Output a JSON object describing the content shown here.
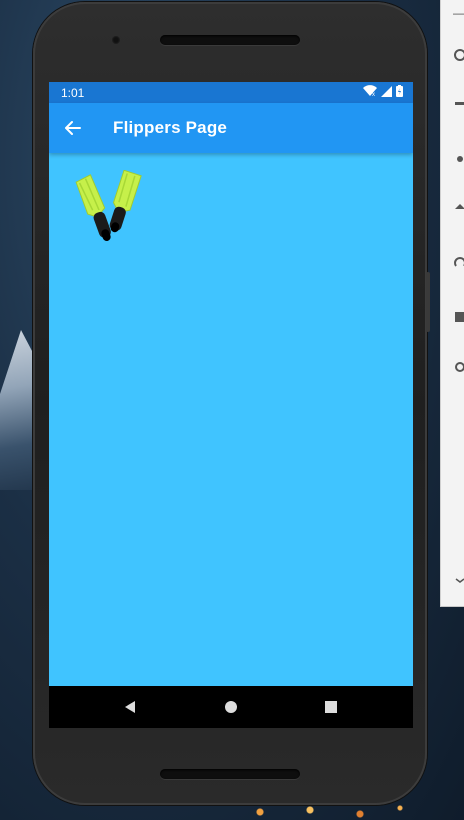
{
  "status_bar": {
    "time": "1:01",
    "icons": [
      "wifi-icon",
      "signal-icon",
      "battery-icon"
    ]
  },
  "app_bar": {
    "title": "Flippers Page",
    "back_icon": "arrow-back-icon",
    "color": "#2196f3"
  },
  "content": {
    "background": "#40c4ff",
    "image": "flippers-image"
  },
  "nav_bar": {
    "buttons": [
      "back-triangle-icon",
      "home-circle-icon",
      "recents-square-icon"
    ]
  },
  "emulator_toolbar": {
    "minimize_label": "—"
  }
}
